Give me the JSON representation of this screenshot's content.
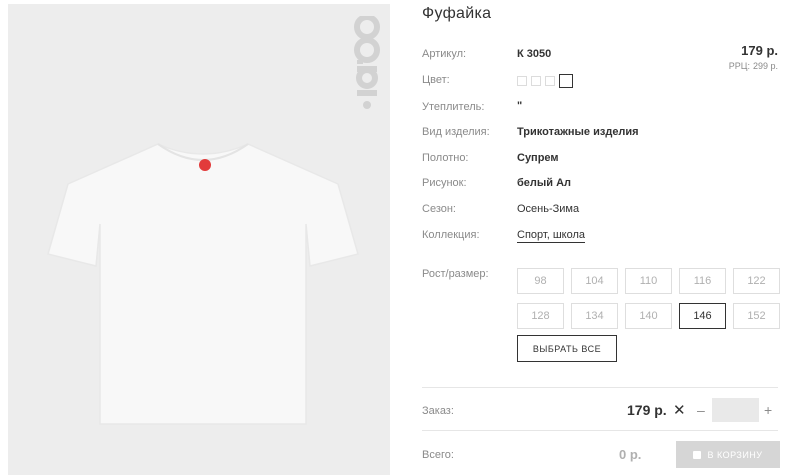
{
  "brand": {
    "logo_text": "орби"
  },
  "product": {
    "title": "Фуфайка",
    "price": "179 р.",
    "rrp": {
      "label": "РРЦ:",
      "value": "299 р."
    }
  },
  "attributes": [
    {
      "label": "Артикул:",
      "value": "К 3050"
    },
    {
      "label": "Цвет:"
    },
    {
      "label": "Утеплитель:",
      "value": "\""
    },
    {
      "label": "Вид изделия:",
      "value": "Трикотажные изделия"
    },
    {
      "label": "Полотно:",
      "value": "Супрем"
    },
    {
      "label": "Рисунок:",
      "value": "белый Ал"
    },
    {
      "label": "Сезон:",
      "value": "Осень-Зима"
    },
    {
      "label": "Коллекция:",
      "value": "Спорт, школа"
    }
  ],
  "sizes": {
    "label": "Рост/размер:",
    "options": [
      "98",
      "104",
      "110",
      "116",
      "122",
      "128",
      "134",
      "140",
      "146",
      "152"
    ],
    "selected": "146",
    "select_all_label": "ВЫБРАТЬ ВСЕ"
  },
  "order": {
    "label": "Заказ:",
    "price": "179 р.",
    "times": "✕",
    "minus": "–",
    "plus": "+",
    "qty": ""
  },
  "total": {
    "label": "Всего:",
    "value": "0 р.",
    "cart_label": "В КОРЗИНУ"
  },
  "colors": {
    "photo_bg": "#ededed",
    "accent_logo": "#d2d2d2",
    "tag_red": "#e23b3b"
  }
}
